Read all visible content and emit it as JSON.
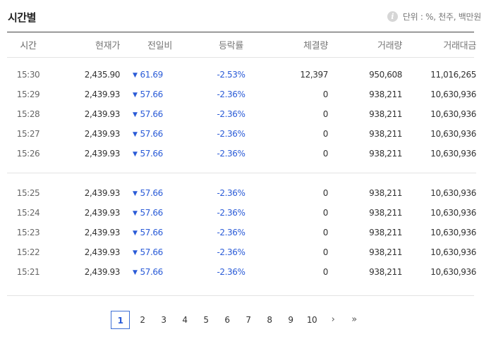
{
  "title": "시간별",
  "unit_text": "단위 : %, 천주, 백만원",
  "info_icon_glyph": "i",
  "columns": [
    "시간",
    "현재가",
    "전일비",
    "등락률",
    "체결량",
    "거래량",
    "거래대금"
  ],
  "down_color": "#2a5bd7",
  "groups": [
    [
      {
        "time": "15:30",
        "price": "2,435.90",
        "change": "61.69",
        "rate": "-2.53%",
        "exec": "12,397",
        "volume": "950,608",
        "amount": "11,016,265"
      },
      {
        "time": "15:29",
        "price": "2,439.93",
        "change": "57.66",
        "rate": "-2.36%",
        "exec": "0",
        "volume": "938,211",
        "amount": "10,630,936"
      },
      {
        "time": "15:28",
        "price": "2,439.93",
        "change": "57.66",
        "rate": "-2.36%",
        "exec": "0",
        "volume": "938,211",
        "amount": "10,630,936"
      },
      {
        "time": "15:27",
        "price": "2,439.93",
        "change": "57.66",
        "rate": "-2.36%",
        "exec": "0",
        "volume": "938,211",
        "amount": "10,630,936"
      },
      {
        "time": "15:26",
        "price": "2,439.93",
        "change": "57.66",
        "rate": "-2.36%",
        "exec": "0",
        "volume": "938,211",
        "amount": "10,630,936"
      }
    ],
    [
      {
        "time": "15:25",
        "price": "2,439.93",
        "change": "57.66",
        "rate": "-2.36%",
        "exec": "0",
        "volume": "938,211",
        "amount": "10,630,936"
      },
      {
        "time": "15:24",
        "price": "2,439.93",
        "change": "57.66",
        "rate": "-2.36%",
        "exec": "0",
        "volume": "938,211",
        "amount": "10,630,936"
      },
      {
        "time": "15:23",
        "price": "2,439.93",
        "change": "57.66",
        "rate": "-2.36%",
        "exec": "0",
        "volume": "938,211",
        "amount": "10,630,936"
      },
      {
        "time": "15:22",
        "price": "2,439.93",
        "change": "57.66",
        "rate": "-2.36%",
        "exec": "0",
        "volume": "938,211",
        "amount": "10,630,936"
      },
      {
        "time": "15:21",
        "price": "2,439.93",
        "change": "57.66",
        "rate": "-2.36%",
        "exec": "0",
        "volume": "938,211",
        "amount": "10,630,936"
      }
    ]
  ],
  "pagination": {
    "current": "1",
    "pages": [
      "1",
      "2",
      "3",
      "4",
      "5",
      "6",
      "7",
      "8",
      "9",
      "10"
    ],
    "next_glyph": "›",
    "last_glyph": "»"
  }
}
